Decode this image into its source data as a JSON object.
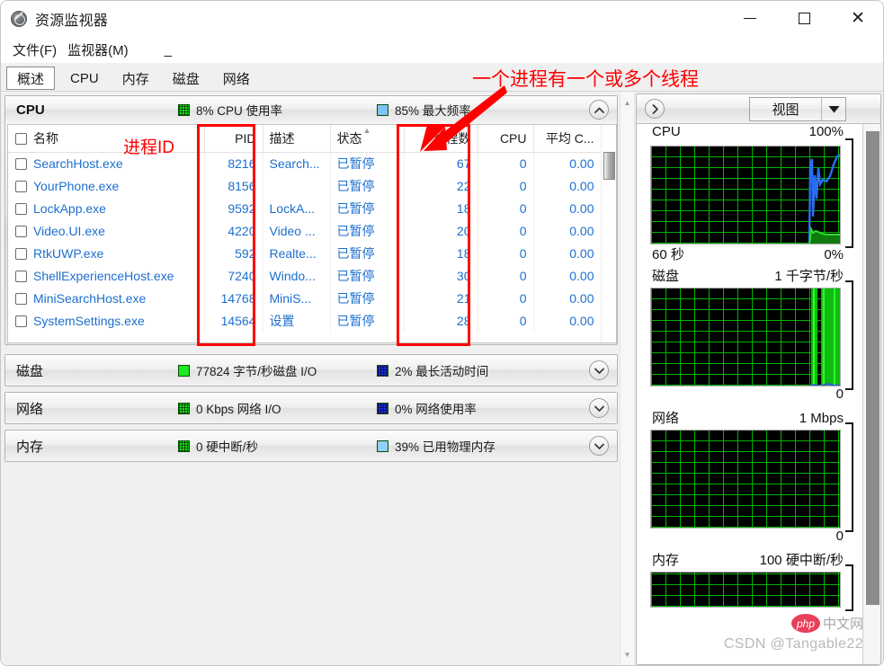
{
  "window": {
    "title": "资源监视器",
    "app_icon": "resource-monitor-icon",
    "controls": {
      "minimize": "—",
      "maximize": "□",
      "close": "✕"
    }
  },
  "menu": {
    "items": [
      {
        "label": "文件(F)",
        "mnemonic": "F"
      },
      {
        "label": "监视器(M)",
        "mnemonic": "M"
      }
    ],
    "trailing_dash": "_"
  },
  "tabs": {
    "selected": "概述",
    "items": [
      "概述",
      "CPU",
      "内存",
      "磁盘",
      "网络"
    ]
  },
  "sections": {
    "cpu": {
      "title": "CPU",
      "expanded": true,
      "stats": [
        {
          "swatch": "green-grid",
          "label": "8% CPU 使用率"
        },
        {
          "swatch": "light-blue",
          "label": "85% 最大频率"
        }
      ],
      "chevron": "chevron-up-icon",
      "columns": [
        {
          "key": "name",
          "label": "名称",
          "align": "left"
        },
        {
          "key": "pid",
          "label": "PID",
          "align": "right"
        },
        {
          "key": "desc",
          "label": "描述",
          "align": "left"
        },
        {
          "key": "status",
          "label": "状态",
          "align": "left",
          "sorted": true
        },
        {
          "key": "threads",
          "label": "线程数",
          "align": "right"
        },
        {
          "key": "cpu",
          "label": "CPU",
          "align": "right"
        },
        {
          "key": "avgcpu",
          "label": "平均 C...",
          "align": "right"
        }
      ],
      "rows": [
        {
          "name": "SearchHost.exe",
          "pid": "8216",
          "desc": "Search...",
          "status": "已暂停",
          "threads": "67",
          "cpu": "0",
          "avgcpu": "0.00"
        },
        {
          "name": "YourPhone.exe",
          "pid": "8156",
          "desc": "",
          "status": "已暂停",
          "threads": "22",
          "cpu": "0",
          "avgcpu": "0.00"
        },
        {
          "name": "LockApp.exe",
          "pid": "9592",
          "desc": "LockA...",
          "status": "已暂停",
          "threads": "18",
          "cpu": "0",
          "avgcpu": "0.00"
        },
        {
          "name": "Video.UI.exe",
          "pid": "4220",
          "desc": "Video ...",
          "status": "已暂停",
          "threads": "20",
          "cpu": "0",
          "avgcpu": "0.00"
        },
        {
          "name": "RtkUWP.exe",
          "pid": "592",
          "desc": "Realte...",
          "status": "已暂停",
          "threads": "18",
          "cpu": "0",
          "avgcpu": "0.00"
        },
        {
          "name": "ShellExperienceHost.exe",
          "pid": "7240",
          "desc": "Windo...",
          "status": "已暂停",
          "threads": "30",
          "cpu": "0",
          "avgcpu": "0.00"
        },
        {
          "name": "MiniSearchHost.exe",
          "pid": "14768",
          "desc": "MiniS...",
          "status": "已暂停",
          "threads": "21",
          "cpu": "0",
          "avgcpu": "0.00"
        },
        {
          "name": "SystemSettings.exe",
          "pid": "14564",
          "desc": "设置",
          "status": "已暂停",
          "threads": "28",
          "cpu": "0",
          "avgcpu": "0.00"
        }
      ]
    },
    "disk": {
      "title": "磁盘",
      "expanded": false,
      "chevron": "chevron-down-icon",
      "stats": [
        {
          "swatch": "solid-green",
          "label": "77824 字节/秒磁盘 I/O"
        },
        {
          "swatch": "dark-blue",
          "label": "2% 最长活动时间"
        }
      ]
    },
    "network": {
      "title": "网络",
      "expanded": false,
      "chevron": "chevron-down-icon",
      "stats": [
        {
          "swatch": "green-grid",
          "label": "0 Kbps 网络 I/O"
        },
        {
          "swatch": "dark-blue",
          "label": "0% 网络使用率"
        }
      ]
    },
    "memory": {
      "title": "内存",
      "expanded": false,
      "chevron": "chevron-down-icon",
      "stats": [
        {
          "swatch": "green-grid",
          "label": "0 硬中断/秒"
        },
        {
          "swatch": "light-blue",
          "label": "39% 已用物理内存"
        }
      ]
    }
  },
  "right_panel": {
    "collapse_icon": "chevron-right-icon",
    "view_button": {
      "label": "视图",
      "arrow_icon": "triangle-down-icon"
    },
    "graphs": [
      {
        "name": "CPU",
        "top_right": "100%",
        "bottom_left": "60 秒",
        "bottom_right": "0%"
      },
      {
        "name": "磁盘",
        "top_right": "1 千字节/秒",
        "bottom_left": "",
        "bottom_right": "0"
      },
      {
        "name": "网络",
        "top_right": "1 Mbps",
        "bottom_left": "",
        "bottom_right": "0"
      },
      {
        "name": "内存",
        "top_right": "100 硬中断/秒",
        "bottom_left": "",
        "bottom_right": ""
      }
    ]
  },
  "annotations": [
    {
      "id": "threads-note",
      "text": "一个进程有一个或多个线程",
      "color": "#ff0000"
    },
    {
      "id": "pid-note",
      "text": "进程ID",
      "color": "#ff0000"
    }
  ],
  "watermarks": {
    "csdn": "CSDN @Tangable22",
    "php_bubble": "php",
    "php_zh": "中文网"
  },
  "chart_data": [
    {
      "type": "line",
      "title": "CPU",
      "ylabel": "",
      "xlabel": "60 秒",
      "ylim": [
        0,
        100
      ],
      "y_top_label": "100%",
      "y_bottom_label": "0%",
      "grid": true,
      "series": [
        {
          "name": "最大频率",
          "color": "#2b6ef2",
          "values": [
            0,
            0,
            0,
            0,
            0,
            0,
            0,
            0,
            0,
            0,
            0,
            0,
            0,
            0,
            0,
            0,
            0,
            0,
            0,
            0,
            0,
            0,
            0,
            0,
            0,
            0,
            0,
            0,
            0,
            0,
            0,
            0,
            0,
            0,
            0,
            0,
            0,
            0,
            0,
            0,
            0,
            0,
            0,
            0,
            0,
            0,
            0,
            0,
            0,
            2,
            88,
            92,
            72,
            90,
            66,
            80,
            84,
            78,
            82,
            88
          ]
        },
        {
          "name": "CPU 使用率",
          "color": "#18c018",
          "values": [
            0,
            0,
            0,
            0,
            0,
            0,
            0,
            0,
            0,
            0,
            0,
            0,
            0,
            0,
            0,
            0,
            0,
            0,
            0,
            0,
            0,
            0,
            0,
            0,
            0,
            0,
            0,
            0,
            0,
            0,
            0,
            0,
            0,
            0,
            0,
            0,
            0,
            0,
            0,
            0,
            0,
            0,
            0,
            0,
            0,
            0,
            0,
            0,
            0,
            0,
            14,
            9,
            8,
            9,
            8,
            8,
            8,
            8,
            8,
            8
          ]
        }
      ]
    },
    {
      "type": "area",
      "title": "磁盘",
      "ylabel": "",
      "xlabel": "",
      "y_top_label": "1 千字节/秒",
      "y_bottom_label": "0",
      "grid": true,
      "series": [
        {
          "name": "磁盘 I/O",
          "color": "#00d800",
          "values": [
            0,
            0,
            0,
            0,
            0,
            0,
            0,
            0,
            0,
            0,
            0,
            0,
            0,
            0,
            0,
            0,
            0,
            0,
            0,
            0,
            0,
            0,
            0,
            0,
            0,
            0,
            0,
            0,
            0,
            0,
            0,
            0,
            0,
            0,
            0,
            0,
            0,
            0,
            0,
            0,
            0,
            0,
            0,
            0,
            0,
            0,
            0,
            0,
            0,
            0,
            0,
            100,
            100,
            0,
            100,
            100,
            100,
            100,
            100,
            100
          ]
        },
        {
          "name": "最长活动时间",
          "color": "#3355ee",
          "values": [
            0,
            0,
            0,
            0,
            0,
            0,
            0,
            0,
            0,
            0,
            0,
            0,
            0,
            0,
            0,
            0,
            0,
            0,
            0,
            0,
            0,
            0,
            0,
            0,
            0,
            0,
            0,
            0,
            0,
            0,
            0,
            0,
            0,
            0,
            0,
            0,
            0,
            0,
            0,
            0,
            0,
            0,
            0,
            0,
            0,
            0,
            0,
            0,
            0,
            0,
            2,
            2,
            2,
            2,
            2,
            2,
            2,
            2,
            2,
            2
          ]
        }
      ]
    },
    {
      "type": "area",
      "title": "网络",
      "ylabel": "",
      "xlabel": "",
      "y_top_label": "1 Mbps",
      "y_bottom_label": "0",
      "grid": true,
      "series": [
        {
          "name": "网络 I/O",
          "color": "#00d800",
          "values": [
            0,
            0,
            0,
            0,
            0,
            0,
            0,
            0,
            0,
            0,
            0,
            0,
            0,
            0,
            0,
            0,
            0,
            0,
            0,
            0,
            0,
            0,
            0,
            0,
            0,
            0,
            0,
            0,
            0,
            0,
            0,
            0,
            0,
            0,
            0,
            0,
            0,
            0,
            0,
            0,
            0,
            0,
            0,
            0,
            0,
            0,
            0,
            0,
            0,
            0,
            0,
            0,
            0,
            0,
            0,
            0,
            0,
            0,
            0,
            0
          ]
        }
      ]
    },
    {
      "type": "area",
      "title": "内存",
      "ylabel": "",
      "xlabel": "",
      "y_top_label": "100 硬中断/秒",
      "y_bottom_label": "",
      "grid": true,
      "series": [
        {
          "name": "硬中断/秒",
          "color": "#00d800",
          "values": [
            0,
            0,
            0,
            0,
            0,
            0,
            0,
            0,
            0,
            0,
            0,
            0,
            0,
            0,
            0,
            0,
            0,
            0,
            0,
            0,
            0,
            0,
            0,
            0,
            0,
            0,
            0,
            0,
            0,
            0,
            0,
            0,
            0,
            0,
            0,
            0,
            0,
            0,
            0,
            0,
            0,
            0,
            0,
            0,
            0,
            0,
            0,
            0,
            0,
            0,
            0,
            0,
            0,
            0,
            0,
            0,
            0,
            0,
            0,
            0
          ]
        }
      ]
    }
  ]
}
